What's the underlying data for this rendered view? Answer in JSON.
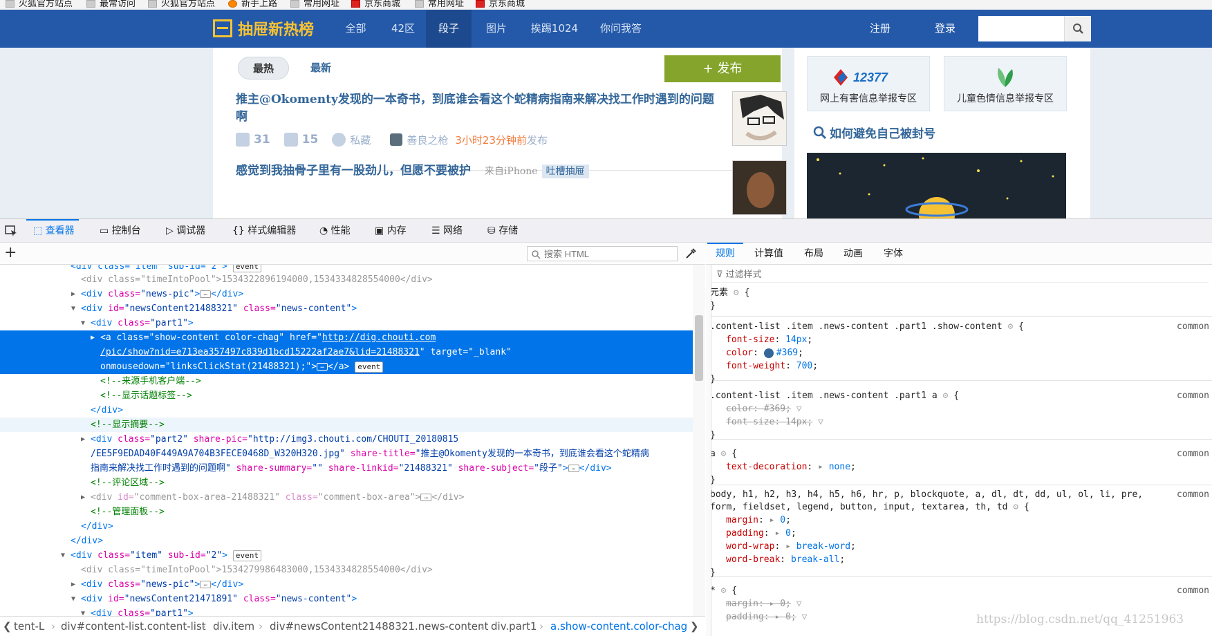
{
  "browser": {
    "bookmarks": [
      "火狐官方站点",
      "最常访问",
      "火狐官方站点",
      "新手上路",
      "常用网址",
      "京东商城",
      "常用网址",
      "京东商城"
    ]
  },
  "site": {
    "logo_text": "抽屉新热榜",
    "nav": [
      "全部",
      "42区",
      "段子",
      "图片",
      "挨踢1024",
      "你问我答"
    ],
    "nav_active": "段子",
    "register": "注册",
    "login": "登录",
    "search_value": "",
    "sort_hot": "最热",
    "sort_new": "最新",
    "publish": "+ 发布",
    "items": [
      {
        "title": "推主@Okomenty发现的一本奇书，到底谁会看这个蛇精病指南来解决找工作时遇到的问题啊",
        "likes": "31",
        "comments": "15",
        "fav": "私藏",
        "author": "善良之枪",
        "time": "3小时23分钟前",
        "time_suffix": "发布"
      },
      {
        "title": "感觉到我抽骨子里有一股劲儿，但愿不要被护",
        "source": "来自iPhone",
        "topic": "吐槽抽屉"
      }
    ],
    "report1": "网上有害信息举报专区",
    "report1_logo": "12377",
    "report2": "儿童色情信息举报专区",
    "howto": "如何避免自己被封号"
  },
  "devtools": {
    "tabs": [
      "查看器",
      "控制台",
      "调试器",
      "样式编辑器",
      "性能",
      "内存",
      "网络",
      "存储"
    ],
    "active_tab": "查看器",
    "search_placeholder": "搜索 HTML",
    "lines": {
      "l0a": "<div class=\"item\" sub-id=\"2\">",
      "l1": "1534322896194000,1534334828554000",
      "l3": "newsContent21488321",
      "l5a": "http://dig.chouti.com",
      "l5b": "/pic/show?nid=e713ea357497c839d1bcd15222af2ae7&lid=21488321",
      "l5c": "linksClickStat(21488321);",
      "c1": "<!--来源手机客户端-->",
      "c2": "<!--显示话题标签-->",
      "c3": "<!--显示摘要-->",
      "sharepic_a": "http://img3.chouti.com/CHOUTI_20180815",
      "sharepic_b": "/EE5F9EDAD40F449A9A704B3FECE0468D_W320H320.jpg",
      "share_title_a": "推主@Okomenty发现的一本奇书，到底谁会看这个蛇精病",
      "share_title_b": "指南来解决找工作时遇到的问题啊",
      "share_linkid": "21488321",
      "share_subject": "段子",
      "c4": "<!--评论区域-->",
      "comment_box": "comment-box-area-21488321",
      "c5": "<!--管理面板-->",
      "l2_time": "1534279986483000,1534334828554000",
      "l2_news": "newsContent21471891",
      "event": "event"
    },
    "breadcrumbs": [
      "tent-L",
      "div#content-list.content-list",
      "div.item",
      "div#newsContent21488321.news-content",
      "div.part1",
      "a.show-content.color-chag"
    ],
    "rp_tabs": [
      "规则",
      "计算值",
      "布局",
      "动画",
      "字体"
    ],
    "filter_placeholder": "过滤样式",
    "element_label": "元素",
    "rule_source": "common",
    "rules": {
      "sel1": ".content-list .item .news-content .part1 .show-content",
      "sel2": ".content-list .item .news-content .part1 a",
      "sel3": "a",
      "sel4a": "body, h1, h2, h3, h4, h5, h6, hr, p, blockquote, a, dl, dt, dd, ul, ol, li, pre,",
      "sel4b": "form, fieldset, legend, button, input, textarea, th, td",
      "sel5": "*",
      "fs": "14px",
      "color": "#369",
      "fw": "700",
      "td": "none",
      "zero": "0",
      "ww": "break-word",
      "wb": "break-all"
    },
    "colors": {
      "accent": "#0074e8",
      "site_blue": "#2459a9",
      "publish_green": "#84a42b",
      "link": "#336699"
    }
  },
  "watermark": "https://blog.csdn.net/qq_41251963"
}
